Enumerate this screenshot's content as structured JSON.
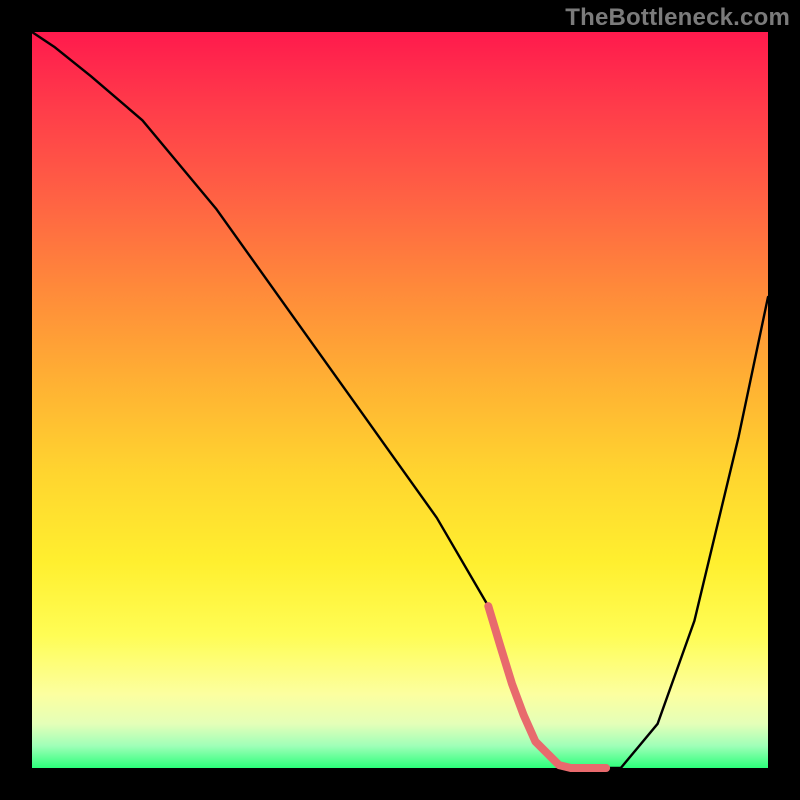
{
  "watermark": "TheBottleneck.com",
  "chart_data": {
    "type": "line",
    "title": "",
    "xlabel": "",
    "ylabel": "",
    "xlim": [
      0,
      100
    ],
    "ylim": [
      0,
      100
    ],
    "series": [
      {
        "name": "curve",
        "x": [
          0,
          3,
          8,
          15,
          25,
          35,
          45,
          55,
          62,
          65,
          68,
          72,
          74,
          80,
          85,
          90,
          96,
          100
        ],
        "y": [
          100,
          98,
          94,
          88,
          76,
          62,
          48,
          34,
          22,
          12,
          4,
          0,
          0,
          0,
          6,
          20,
          45,
          64
        ]
      }
    ],
    "trough": {
      "x_start": 62,
      "x_end": 78,
      "color": "#e86a6d"
    }
  }
}
